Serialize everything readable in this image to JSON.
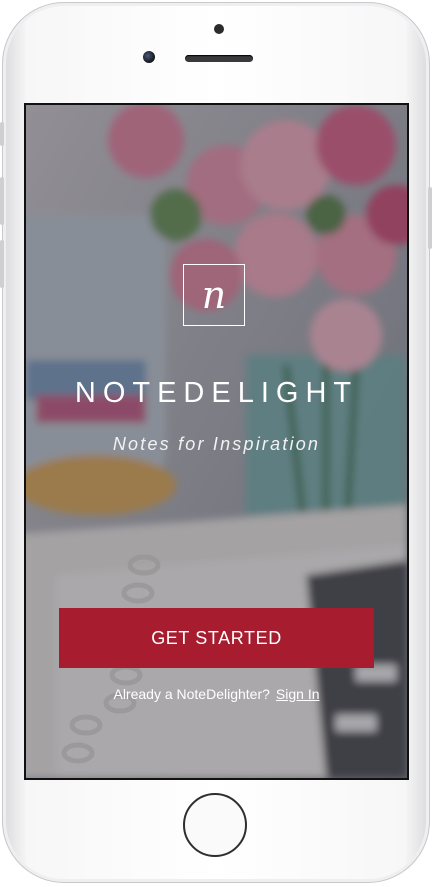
{
  "app": {
    "logo_letter": "n",
    "title": "NOTEDELIGHT",
    "tagline": "Notes for Inspiration"
  },
  "actions": {
    "get_started_label": "GET STARTED",
    "existing_user_prompt": "Already a NoteDelighter?",
    "sign_in_label": "Sign In"
  },
  "colors": {
    "primary": "#a71d2f",
    "text": "#ffffff"
  }
}
